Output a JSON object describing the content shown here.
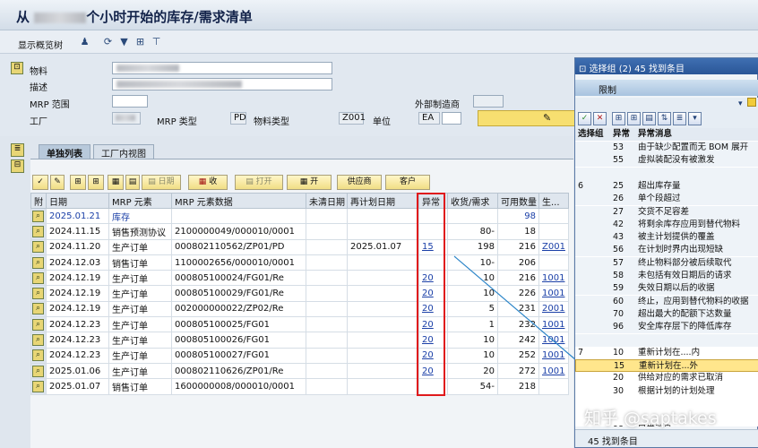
{
  "window": {
    "title_prefix": "从",
    "title_suffix": "个小时开始的库存/需求清单"
  },
  "toolbar": {
    "show_overview": "显示概览树"
  },
  "header": {
    "material_label": "物料",
    "description_label": "描述",
    "mrp_area_label": "MRP 范围",
    "plant_label": "工厂",
    "mrp_type_label": "MRP 类型",
    "mrp_type_value": "PD",
    "material_type_label": "物料类型",
    "material_type_value": "Z001",
    "unit_label": "单位",
    "unit_value": "EA",
    "ext_proc_label": "外部制造商"
  },
  "tabs": [
    {
      "label": "单独列表"
    },
    {
      "label": "工厂内视图"
    }
  ],
  "grid_toolbar": {
    "date": "日期",
    "receipt": "收",
    "open": "打开",
    "open2": "开",
    "vendor": "供应商",
    "customer": "客户"
  },
  "grid": {
    "columns": [
      "附",
      "日期",
      "MRP 元素",
      "MRP 元素数据",
      "未清日期",
      "再计划日期",
      "异常",
      "收货/需求",
      "可用数量",
      "生..."
    ],
    "rows": [
      {
        "date": "2025.01.21",
        "elem": "库存",
        "data": "",
        "resched": "",
        "exc": "",
        "qty": "",
        "avail": "98",
        "prod": "",
        "blue": true
      },
      {
        "date": "2024.11.15",
        "elem": "销售预测协议",
        "data": "2100000049/000010/0001",
        "resched": "",
        "exc": "",
        "qty": "80-",
        "avail": "18",
        "prod": ""
      },
      {
        "date": "2024.11.20",
        "elem": "生产订单",
        "data": "000802110562/ZP01/PD",
        "resched": "2025.01.07",
        "exc": "15",
        "qty": "198",
        "avail": "216",
        "prod": "Z001"
      },
      {
        "date": "2024.12.03",
        "elem": "销售订单",
        "data": "1100002656/000010/0001",
        "resched": "",
        "exc": "",
        "qty": "10-",
        "avail": "206",
        "prod": ""
      },
      {
        "date": "2024.12.19",
        "elem": "生产订单",
        "data": "000805100024/FG01/Re",
        "resched": "",
        "exc": "20",
        "qty": "10",
        "avail": "216",
        "prod": "1001"
      },
      {
        "date": "2024.12.19",
        "elem": "生产订单",
        "data": "000805100029/FG01/Re",
        "resched": "",
        "exc": "20",
        "qty": "10",
        "avail": "226",
        "prod": "1001"
      },
      {
        "date": "2024.12.19",
        "elem": "生产订单",
        "data": "002000000022/ZP02/Re",
        "resched": "",
        "exc": "20",
        "qty": "5",
        "avail": "231",
        "prod": "2001"
      },
      {
        "date": "2024.12.23",
        "elem": "生产订单",
        "data": "000805100025/FG01",
        "resched": "",
        "exc": "20",
        "qty": "1",
        "avail": "232",
        "prod": "1001"
      },
      {
        "date": "2024.12.23",
        "elem": "生产订单",
        "data": "000805100026/FG01",
        "resched": "",
        "exc": "20",
        "qty": "10",
        "avail": "242",
        "prod": "1001"
      },
      {
        "date": "2024.12.23",
        "elem": "生产订单",
        "data": "000805100027/FG01",
        "resched": "",
        "exc": "20",
        "qty": "10",
        "avail": "252",
        "prod": "1001"
      },
      {
        "date": "2025.01.06",
        "elem": "生产订单",
        "data": "000802110626/ZP01/Re",
        "resched": "",
        "exc": "20",
        "qty": "20",
        "avail": "272",
        "prod": "1001"
      },
      {
        "date": "2025.01.07",
        "elem": "销售订单",
        "data": "1600000008/000010/0001",
        "resched": "",
        "exc": "",
        "qty": "54-",
        "avail": "218",
        "prod": ""
      }
    ]
  },
  "popup": {
    "title": "选择组 (2)  45 找到条目",
    "tab": "限制",
    "col_group": "选择组",
    "col_exc": "异常",
    "col_msg": "异常消息",
    "footer": "45 找到条目",
    "rows": [
      {
        "g": "",
        "c": "53",
        "m": "由于缺少配置而无 BOM 展开"
      },
      {
        "g": "",
        "c": "55",
        "m": "虚拟装配没有被激发"
      },
      {
        "g": "",
        "c": "",
        "m": ""
      },
      {
        "g": "6",
        "c": "25",
        "m": "超出库存量"
      },
      {
        "g": "",
        "c": "26",
        "m": "单个段超过"
      },
      {
        "g": "",
        "c": "27",
        "m": "交货不足容差"
      },
      {
        "g": "",
        "c": "42",
        "m": "将剩余库存应用到替代物料"
      },
      {
        "g": "",
        "c": "43",
        "m": "被主计划提供的覆盖"
      },
      {
        "g": "",
        "c": "56",
        "m": "在计划时界内出现短缺"
      },
      {
        "g": "",
        "c": "57",
        "m": "终止物料部分被后续取代"
      },
      {
        "g": "",
        "c": "58",
        "m": "未包括有效日期后的请求"
      },
      {
        "g": "",
        "c": "59",
        "m": "失效日期以后的收据"
      },
      {
        "g": "",
        "c": "60",
        "m": "终止，应用到替代物料的收据"
      },
      {
        "g": "",
        "c": "70",
        "m": "超出最大的配额下达数量"
      },
      {
        "g": "",
        "c": "96",
        "m": "安全库存层下的降低库存"
      },
      {
        "g": "",
        "c": "",
        "m": ""
      },
      {
        "g": "7",
        "c": "10",
        "m": "重新计划在....内"
      },
      {
        "g": "",
        "c": "15",
        "m": "重新计划在...外",
        "sel": true
      },
      {
        "g": "",
        "c": "20",
        "m": "供给对应的需求已取消"
      },
      {
        "g": "",
        "c": "30",
        "m": "根据计划的计划处理"
      },
      {
        "g": "",
        "c": "",
        "m": ""
      },
      {
        "g": "",
        "c": "",
        "m": ""
      },
      {
        "g": "",
        "c": "98",
        "m": "异常消息"
      }
    ]
  },
  "watermark": "知乎 @saptakes",
  "colors": {
    "highlight": "#e0191c",
    "link": "#1a3fa7",
    "selection": "#ffe68c",
    "callout": "#2a84c8"
  }
}
